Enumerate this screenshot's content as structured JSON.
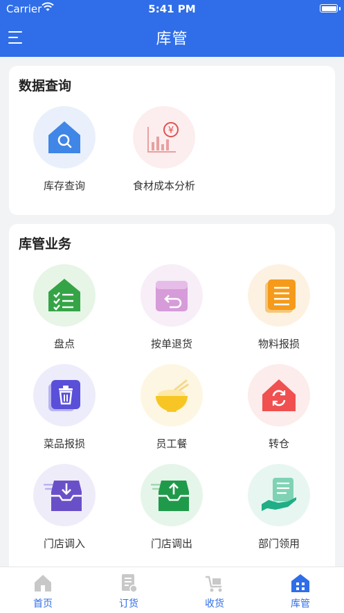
{
  "status_bar": {
    "carrier": "Carrier",
    "time": "5:41 PM"
  },
  "nav": {
    "title": "库管",
    "menu_icon": "menu-icon"
  },
  "sections": [
    {
      "title": "数据查询",
      "items": [
        {
          "label": "库存查询",
          "icon": "inventory-search-icon"
        },
        {
          "label": "食材成本分析",
          "icon": "cost-analysis-icon"
        }
      ]
    },
    {
      "title": "库管业务",
      "items": [
        {
          "label": "盘点",
          "icon": "stocktake-icon"
        },
        {
          "label": "按单退货",
          "icon": "return-order-icon"
        },
        {
          "label": "物料报损",
          "icon": "material-loss-icon"
        },
        {
          "label": "菜品报损",
          "icon": "dish-loss-icon"
        },
        {
          "label": "员工餐",
          "icon": "staff-meal-icon"
        },
        {
          "label": "转仓",
          "icon": "transfer-warehouse-icon"
        },
        {
          "label": "门店调入",
          "icon": "store-transfer-in-icon"
        },
        {
          "label": "门店调出",
          "icon": "store-transfer-out-icon"
        },
        {
          "label": "部门领用",
          "icon": "department-requisition-icon"
        }
      ]
    }
  ],
  "tabbar": {
    "tabs": [
      {
        "label": "首页",
        "icon": "home-icon"
      },
      {
        "label": "订货",
        "icon": "order-icon"
      },
      {
        "label": "收货",
        "icon": "receive-cart-icon"
      },
      {
        "label": "库管",
        "icon": "warehouse-icon",
        "active": true
      }
    ]
  },
  "colors": {
    "brand": "#2f6ee8",
    "background": "#f2f3f5",
    "card": "#ffffff"
  }
}
